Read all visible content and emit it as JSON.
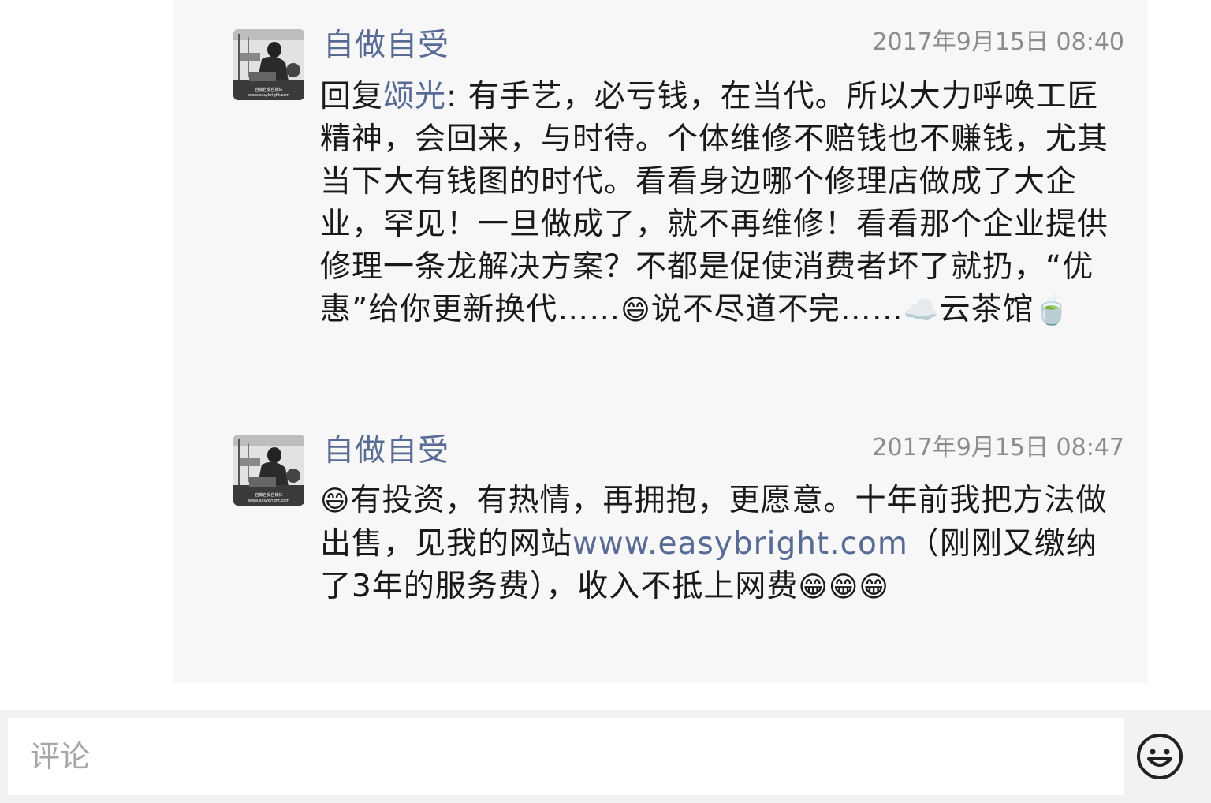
{
  "comments": [
    {
      "author": "自做自受",
      "timestamp": "2017年9月15日 08:40",
      "reply_prefix": "回复",
      "reply_to": "颂光",
      "reply_sep": ": ",
      "text_a": "有手艺，必亏钱，在当代。所以大力呼唤工匠精神，会回来，与时待。个体维修不赔钱也不赚钱，尤其当下大有钱图的时代。看看身边哪个修理店做成了大企业，罕见！一旦做成了，就不再维修！看看那个企业提供修理一条龙解决方案？不都是促使消费者坏了就扔，“优惠”给你更新换代……",
      "emoji_1": "😄",
      "text_b": "说不尽道不完……",
      "emoji_2": "☁️",
      "text_c": "云茶馆",
      "emoji_3": "🍵",
      "avatar_caption": "自做自受自媒体",
      "avatar_url_text": "www.easybright.com"
    },
    {
      "author": "自做自受",
      "timestamp": "2017年9月15日 08:47",
      "emoji_1": "😄",
      "text_a": "有投资，有热情，再拥抱，更愿意。十年前我把方法做出售，见我的网站",
      "link": "www.easybright.com",
      "text_b": "（刚刚又缴纳了3年的服务费），收入不抵上网费",
      "emoji_tail": [
        "😁",
        "😁",
        "😁"
      ],
      "avatar_caption": "自做自受自媒体",
      "avatar_url_text": "www.easybright.com"
    }
  ],
  "input": {
    "placeholder": "评论"
  },
  "icons": {
    "emoji_button": "smiley-face-icon"
  },
  "colors": {
    "name": "#576b95",
    "panel": "#f7f7f7"
  }
}
